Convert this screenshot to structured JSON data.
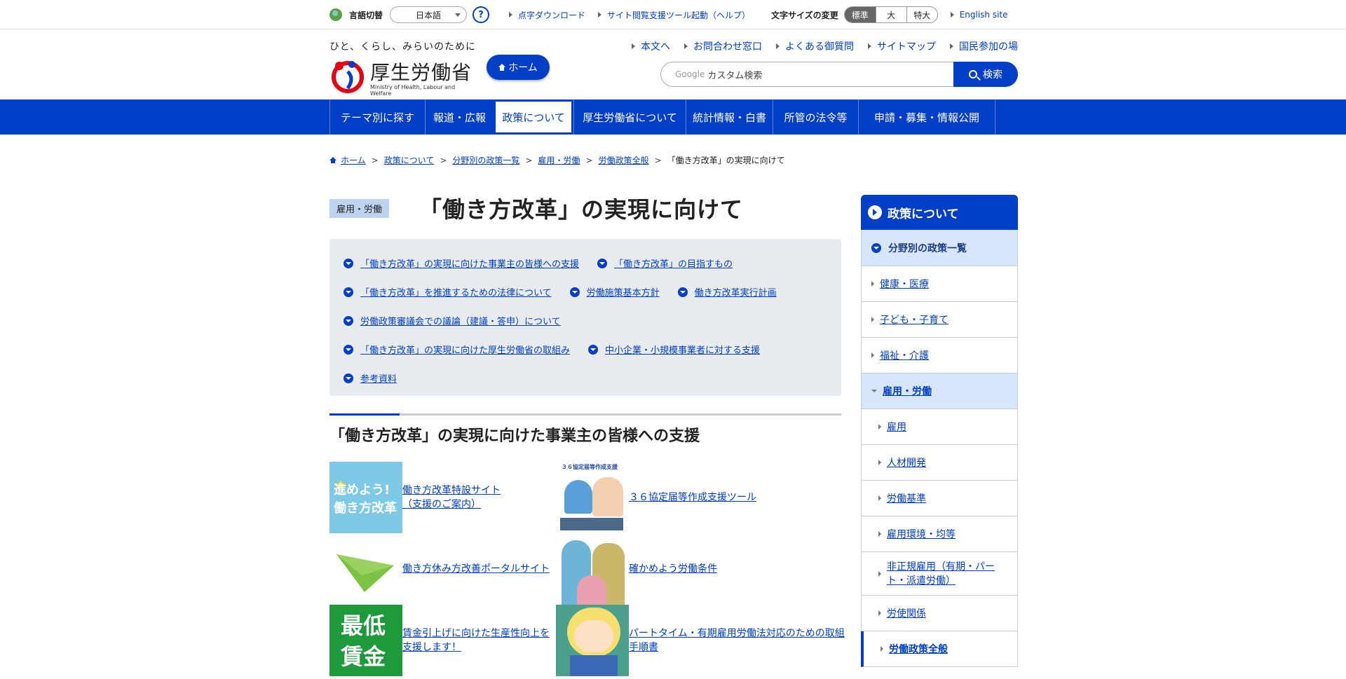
{
  "util": {
    "lang_label": "言語切替",
    "lang_value": "日本語",
    "help": "?",
    "links": [
      "点字ダウンロード",
      "サイト閲覧支援ツール起動（ヘルプ）"
    ],
    "fontsize_label": "文字サイズの変更",
    "fontsizes": [
      "標準",
      "大",
      "特大"
    ],
    "english": "English site"
  },
  "header": {
    "tagline": "ひと、くらし、みらいのために",
    "logo_name": "厚生労働省",
    "logo_en": "Ministry of Health, Labour and Welfare",
    "home_button": "ホーム",
    "links": [
      "本文へ",
      "お問合わせ窓口",
      "よくある御質問",
      "サイトマップ",
      "国民参加の場"
    ],
    "search_brand": "Google",
    "search_placeholder": "カスタム検索",
    "search_button": "検索"
  },
  "gnav": [
    "テーマ別に探す",
    "報道・広報",
    "政策について",
    "厚生労働省について",
    "統計情報・白書",
    "所管の法令等",
    "申請・募集・情報公開"
  ],
  "breadcrumb": [
    "ホーム",
    "政策について",
    "分野別の政策一覧",
    "雇用・労働",
    "労働政策全般",
    "「働き方改革」の実現に向けて"
  ],
  "page": {
    "category": "雇用・労働",
    "title": "「働き方改革」の実現に向けて",
    "toc": [
      [
        "「働き方改革」の実現に向けた事業主の皆様への支援",
        "「働き方改革」の目指すもの"
      ],
      [
        "「働き方改革」を推進するための法律について",
        "労働施策基本方針",
        "働き方改革実行計画"
      ],
      [
        "労働政策審議会での議論（建議・答申）について"
      ],
      [
        "「働き方改革」の実現に向けた厚生労働省の取組み",
        "中小企業・小規模事業者に対する支援"
      ],
      [
        "参考資料"
      ]
    ],
    "section_title": "「働き方改革」の実現に向けた事業主の皆様への支援",
    "cards": [
      {
        "text": "働き方改革特設サイト（支援のご案内）",
        "thumb_text": "進めよう!働き方改革"
      },
      {
        "text": "３６協定届等作成支援ツール",
        "thumb_text": "３６協定届等作成支援"
      },
      {
        "text": "働き方休み方改善ポータルサイト"
      },
      {
        "text": "確かめよう労働条件"
      },
      {
        "text": "賃金引上げに向けた生産性向上を支援します！",
        "thumb_text": "最低賃金"
      },
      {
        "text": "パートタイム・有期雇用労働法対応のための取組手順書"
      }
    ]
  },
  "side": {
    "title": "政策について",
    "sub": "分野別の政策一覧",
    "items": [
      "健康・医療",
      "子ども・子育て",
      "福祉・介護",
      "雇用・労働",
      "雇用",
      "人材開発",
      "労働基準",
      "雇用環境・均等",
      "非正規雇用（有期・パート・派遣労働）",
      "労使関係",
      "労働政策全般"
    ]
  },
  "colors": {
    "primary": "#003fc5",
    "toc_bg": "#e8ecf1",
    "side_active": "#d7e6fb"
  }
}
